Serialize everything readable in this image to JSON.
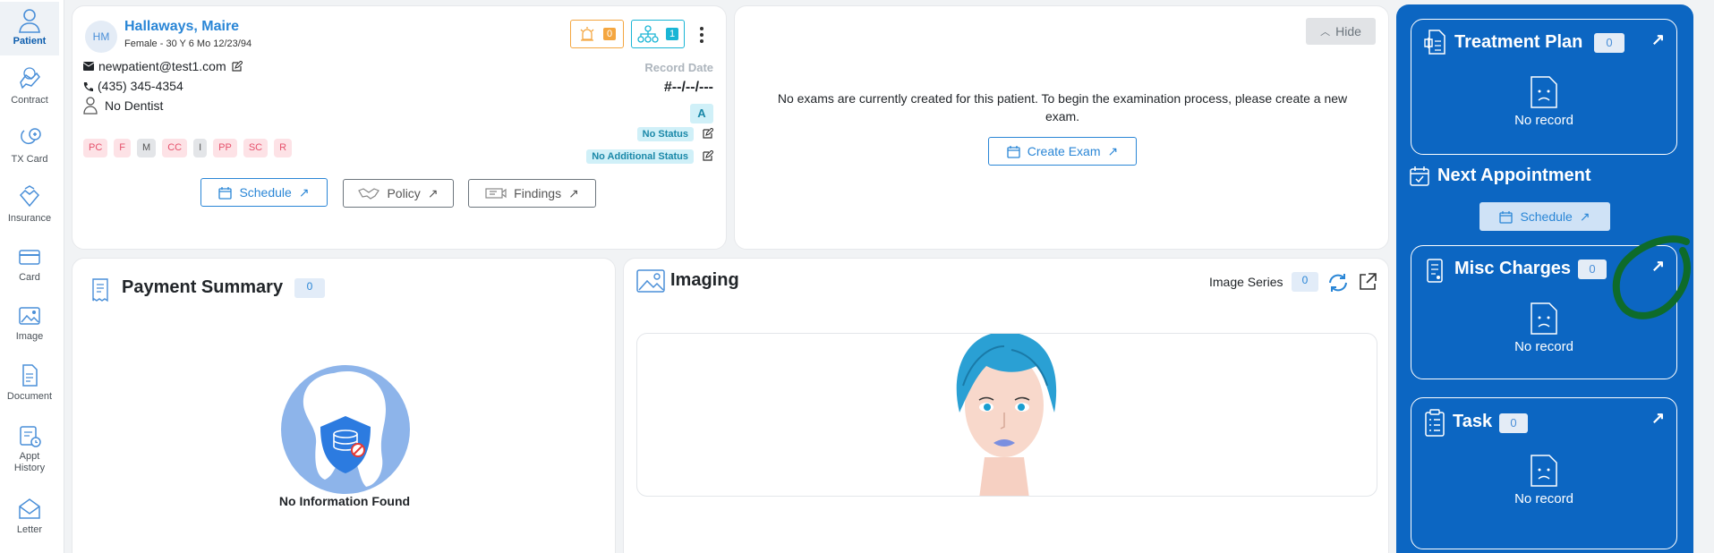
{
  "sidebar": {
    "items": [
      {
        "label": "Patient",
        "icon": "user-icon"
      },
      {
        "label": "Contract",
        "icon": "contract-icon"
      },
      {
        "label": "TX Card",
        "icon": "tx-card-icon"
      },
      {
        "label": "Insurance",
        "icon": "insurance-icon"
      },
      {
        "label": "Card",
        "icon": "credit-card-icon"
      },
      {
        "label": "Image",
        "icon": "image-icon"
      },
      {
        "label": "Document",
        "icon": "document-icon"
      },
      {
        "label": "Appt",
        "label2": "History",
        "icon": "appointment-history-icon"
      },
      {
        "label": "Letter",
        "icon": "letter-icon"
      }
    ]
  },
  "patient": {
    "initials": "HM",
    "name": "Hallaways, Maire",
    "details": "Female - 30 Y 6 Mo 12/23/94",
    "email": "newpatient@test1.com",
    "phone": "(435) 345-4354",
    "dentist": "No Dentist",
    "alert_count": "0",
    "family_count": "1",
    "record_date_label": "Record Date",
    "record_date": "#--/--/---",
    "grade": "A",
    "status": "No Status",
    "additional_status": "No Additional Status",
    "tags": [
      "PC",
      "F",
      "M",
      "CC",
      "I",
      "PP",
      "SC",
      "R"
    ],
    "buttons": {
      "schedule": "Schedule",
      "policy": "Policy",
      "findings": "Findings"
    }
  },
  "exam": {
    "hide_label": "Hide",
    "message": "No exams are currently created for this patient. To begin the examination process, please create a new exam.",
    "create_label": "Create Exam"
  },
  "payment": {
    "title": "Payment Summary",
    "count": "0",
    "empty_text": "No Information Found"
  },
  "imaging": {
    "title": "Imaging",
    "series_label": "Image Series",
    "series_count": "0"
  },
  "right_panel": {
    "treatment_plan": {
      "title": "Treatment Plan",
      "count": "0",
      "empty": "No record"
    },
    "next_appointment": {
      "title": "Next Appointment",
      "schedule_label": "Schedule"
    },
    "misc_charges": {
      "title": "Misc Charges",
      "count": "0",
      "empty": "No record"
    },
    "task": {
      "title": "Task",
      "count": "0",
      "empty": "No record"
    }
  },
  "colors": {
    "accent": "#2a86d6",
    "panel": "#0c66c2",
    "annotation": "#0e6b2a"
  }
}
